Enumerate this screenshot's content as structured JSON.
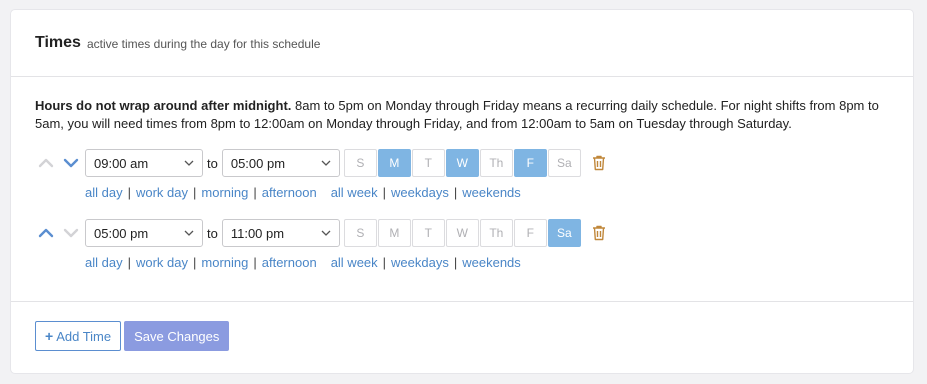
{
  "header": {
    "title": "Times",
    "subtitle": "active times during the day for this schedule"
  },
  "note": {
    "bold": "Hours do not wrap around after midnight.",
    "text": " 8am to 5pm on Monday through Friday means a recurring daily schedule. For night shifts from 8pm to 5am, you will need times from 8pm to 12:00am on Monday through Friday, and from 12:00am to 5am on Tuesday through Saturday."
  },
  "rows": [
    {
      "start": "09:00 am",
      "to_label": "to",
      "end": "05:00 pm",
      "move_up_enabled": false,
      "move_down_enabled": true,
      "days": [
        {
          "label": "S",
          "selected": false
        },
        {
          "label": "M",
          "selected": true
        },
        {
          "label": "T",
          "selected": false
        },
        {
          "label": "W",
          "selected": true
        },
        {
          "label": "Th",
          "selected": false
        },
        {
          "label": "F",
          "selected": true
        },
        {
          "label": "Sa",
          "selected": false
        }
      ]
    },
    {
      "start": "05:00 pm",
      "to_label": "to",
      "end": "11:00 pm",
      "move_up_enabled": true,
      "move_down_enabled": false,
      "days": [
        {
          "label": "S",
          "selected": false
        },
        {
          "label": "M",
          "selected": false
        },
        {
          "label": "T",
          "selected": false
        },
        {
          "label": "W",
          "selected": false
        },
        {
          "label": "Th",
          "selected": false
        },
        {
          "label": "F",
          "selected": false
        },
        {
          "label": "Sa",
          "selected": true
        }
      ]
    }
  ],
  "presets": {
    "times": [
      "all day",
      "work day",
      "morning",
      "afternoon"
    ],
    "days": [
      "all week",
      "weekdays",
      "weekends"
    ]
  },
  "footer": {
    "add_label": "Add Time",
    "save_label": "Save Changes"
  },
  "colors": {
    "accent": "#5b8ed0",
    "day_selected": "#7fb5e3",
    "save_button": "#8b9be0",
    "trash": "#c0873a"
  },
  "icons": {
    "move_up": "chevron-up-icon",
    "move_down": "chevron-down-icon",
    "delete": "trash-icon",
    "add": "plus-icon",
    "select": "caret-down-icon"
  }
}
